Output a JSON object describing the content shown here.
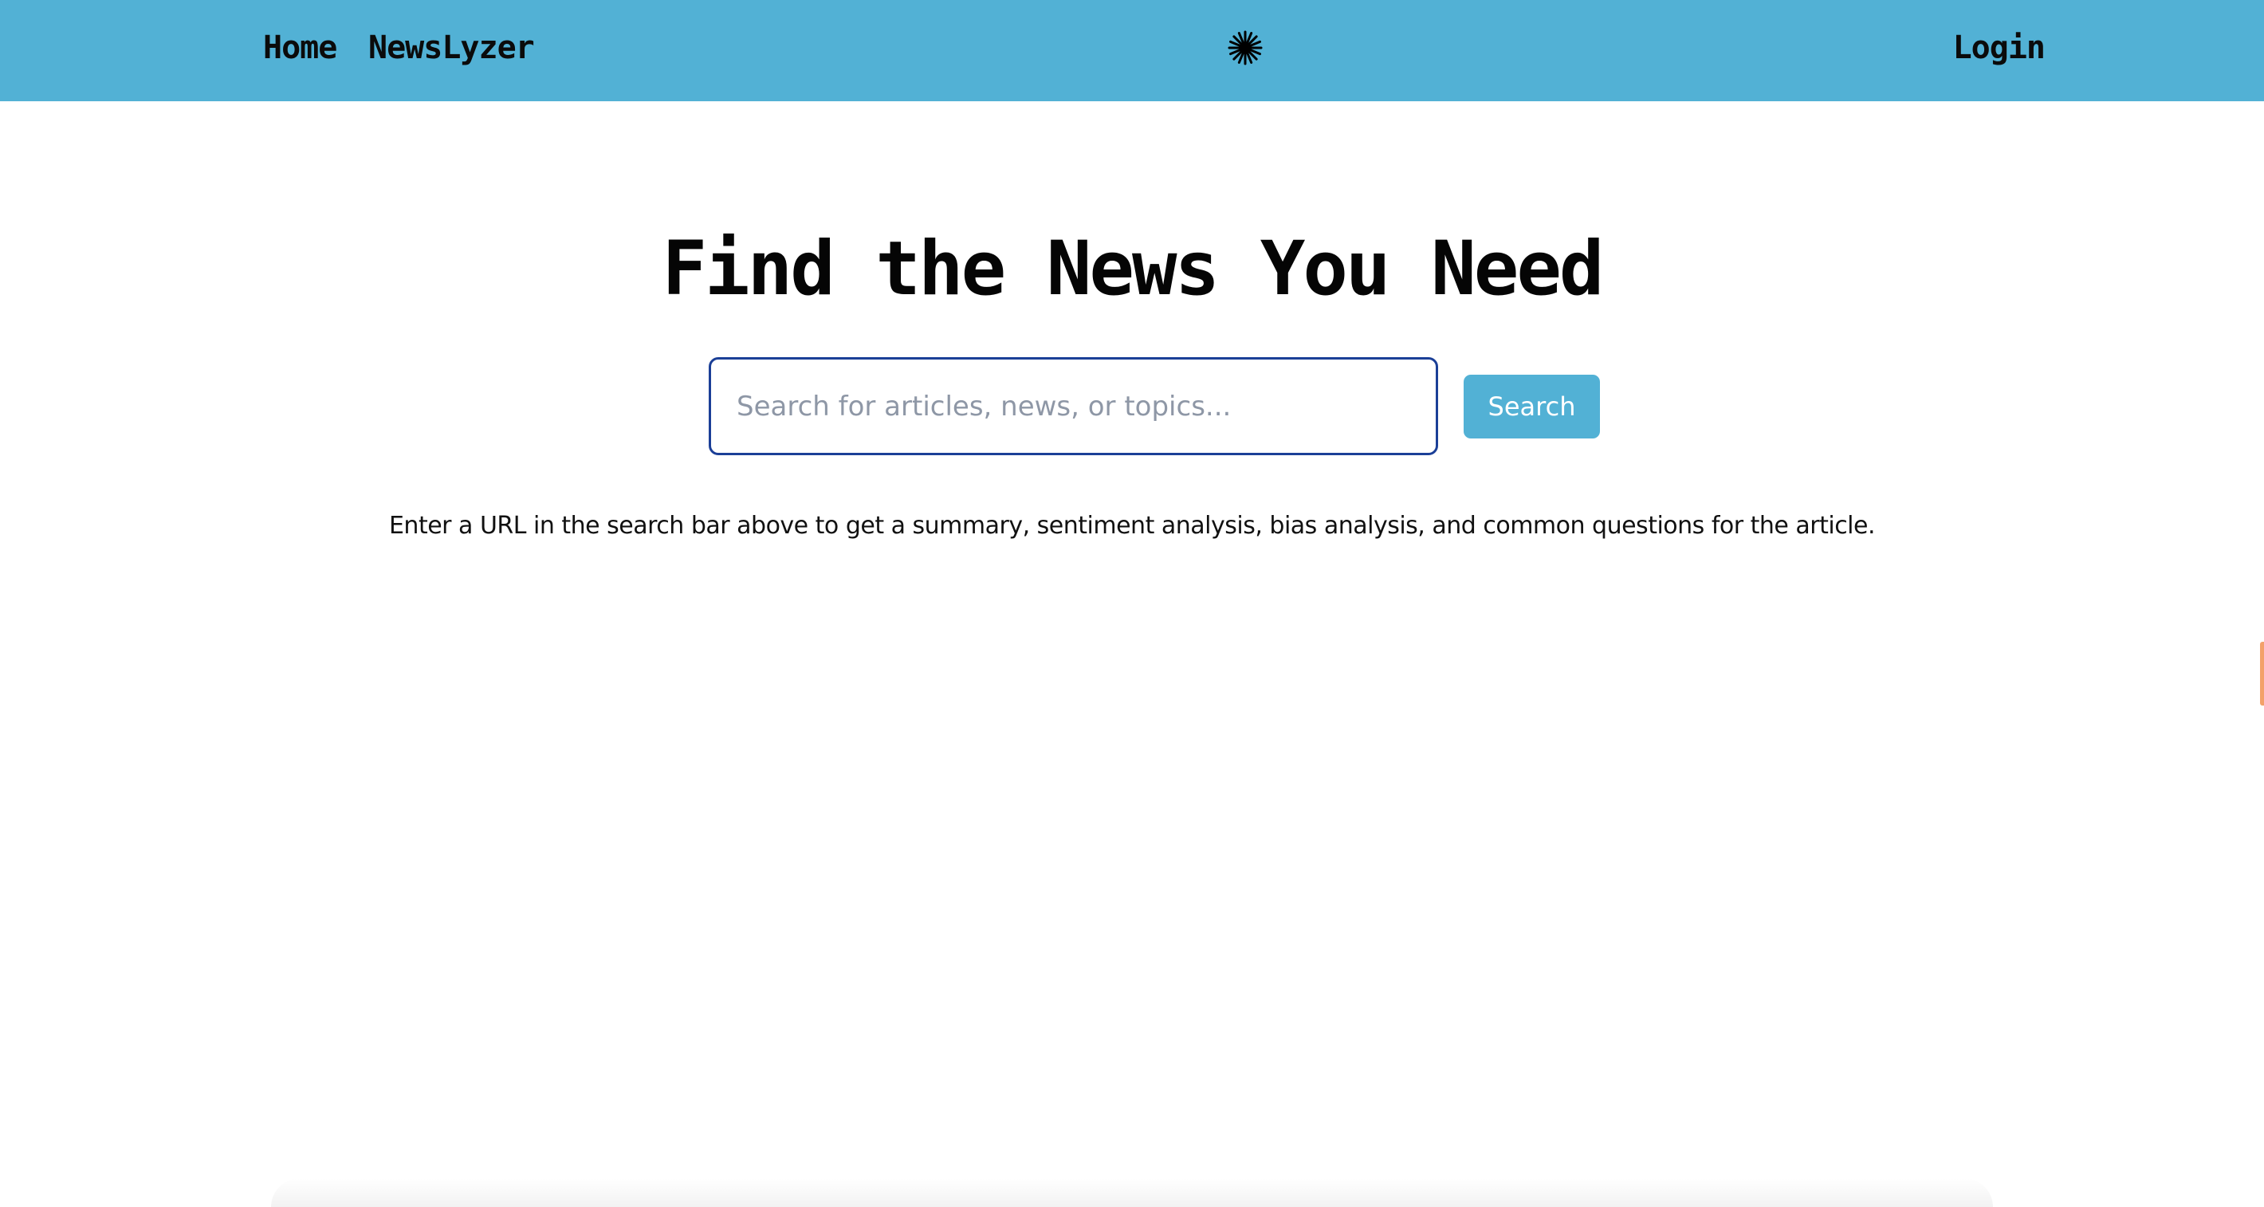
{
  "navbar": {
    "home_label": "Home",
    "brand_label": "NewsLyzer",
    "logo_icon": "asterisk-burst-icon",
    "login_label": "Login",
    "background_color": "#52b1d5"
  },
  "hero": {
    "title": "Find the News You Need"
  },
  "search": {
    "placeholder": "Search for articles, news, or topics...",
    "value": "",
    "button_label": "Search",
    "border_color": "#1b3f97",
    "button_color": "#52b1d5"
  },
  "instructions": {
    "text": "Enter a URL in the search bar above to get a summary, sentiment analysis, bias analysis, and common questions for the article."
  }
}
